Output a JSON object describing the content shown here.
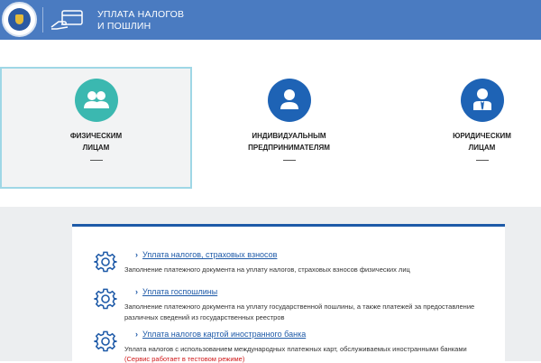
{
  "header": {
    "title_line1": "УПЛАТА НАЛОГОВ",
    "title_line2": "И ПОШЛИН",
    "bg_color": "#4a7bc1"
  },
  "categories": [
    {
      "label_line1": "ФИЗИЧЕСКИМ",
      "label_line2": "ЛИЦАМ",
      "icon": "people-icon",
      "color": "#3bb8b0",
      "active": true
    },
    {
      "label_line1": "ИНДИВИДУАЛЬНЫМ",
      "label_line2": "ПРЕДПРИНИМАТЕЛЯМ",
      "icon": "person-icon",
      "color": "#1e63b5",
      "active": false
    },
    {
      "label_line1": "ЮРИДИЧЕСКИМ",
      "label_line2": "ЛИЦАМ",
      "icon": "businessman-icon",
      "color": "#1e63b5",
      "active": false
    }
  ],
  "services": [
    {
      "title": "Уплата налогов, страховых взносов",
      "desc": "Заполнение платежного документа на уплату налогов, страховых взносов физических лиц"
    },
    {
      "title": "Уплата госпошлины",
      "desc": "Заполнение платежного документа на уплату государственной пошлины, а также платежей за предоставление различных сведений из государственных реестров"
    },
    {
      "title": "Уплата налогов картой иностранного банка",
      "desc": "Уплата налогов с использованием международных платежных карт, обслуживаемых иностранными банками",
      "note": "(Сервис работает в тестовом режиме)"
    }
  ],
  "colors": {
    "link": "#1e5aa8",
    "accent_border": "#1e5aa8",
    "note_red": "#d0191b"
  }
}
